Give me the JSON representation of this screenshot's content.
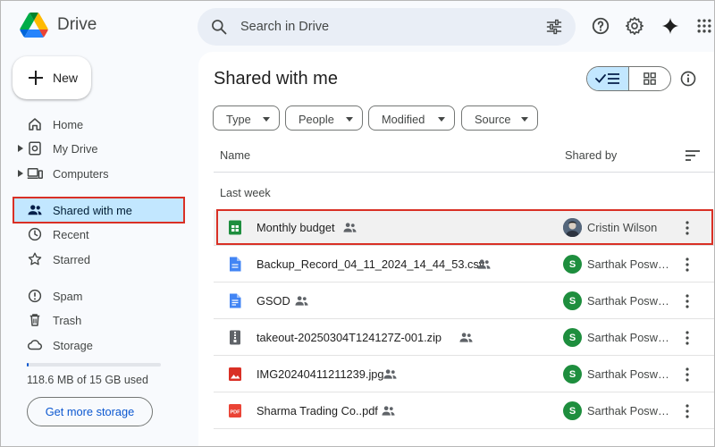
{
  "header": {
    "app_name": "Drive",
    "search_placeholder": "Search in Drive"
  },
  "sidebar": {
    "new_label": "New",
    "items": [
      {
        "label": "Home",
        "icon": "home-icon"
      },
      {
        "label": "My Drive",
        "icon": "my-drive-icon"
      },
      {
        "label": "Computers",
        "icon": "computers-icon"
      },
      {
        "label": "Shared with me",
        "icon": "shared-with-me-icon",
        "active": true
      },
      {
        "label": "Recent",
        "icon": "clock-icon"
      },
      {
        "label": "Starred",
        "icon": "star-icon"
      },
      {
        "label": "Spam",
        "icon": "spam-icon"
      },
      {
        "label": "Trash",
        "icon": "trash-icon"
      },
      {
        "label": "Storage",
        "icon": "cloud-icon"
      }
    ],
    "storage_text": "118.6 MB of 15 GB used",
    "storage_fraction": 0.008,
    "storage_button": "Get more storage"
  },
  "main": {
    "title": "Shared with me",
    "filters": [
      "Type",
      "People",
      "Modified",
      "Source"
    ],
    "columns": {
      "name": "Name",
      "shared_by": "Shared by"
    },
    "section": "Last week",
    "files": [
      {
        "name": "Monthly budget",
        "type": "sheets",
        "shared_by": "Cristin Wilson",
        "avatar_letter": "",
        "selected": true
      },
      {
        "name": "Backup_Record_04_11_2024_14_44_53.csv",
        "type": "csv",
        "shared_by": "Sarthak Posw…",
        "avatar_letter": "S"
      },
      {
        "name": "GSOD",
        "type": "docs",
        "shared_by": "Sarthak Posw…",
        "avatar_letter": "S"
      },
      {
        "name": "takeout-20250304T124127Z-001.zip",
        "type": "zip",
        "shared_by": "Sarthak Posw…",
        "avatar_letter": "S"
      },
      {
        "name": "IMG20240411211239.jpg",
        "type": "image",
        "shared_by": "Sarthak Posw…",
        "avatar_letter": "S"
      },
      {
        "name": "Sharma Trading Co..pdf",
        "type": "pdf",
        "shared_by": "Sarthak Posw…",
        "avatar_letter": "S"
      }
    ]
  },
  "colors": {
    "accent": "#0b57d0",
    "active_nav": "#c2e7ff",
    "highlight": "#d93025",
    "avatar_green": "#1e8e3e"
  }
}
